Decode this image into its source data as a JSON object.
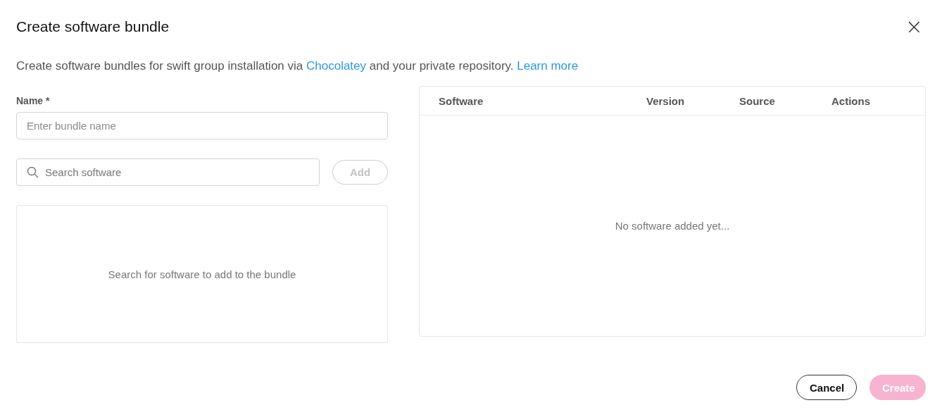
{
  "dialog": {
    "title": "Create software bundle",
    "close": "×"
  },
  "intro": [
    {
      "kind": "text",
      "text": "Create software bundles for swift group installation via "
    },
    {
      "kind": "link",
      "text": "Chocolatey"
    },
    {
      "kind": "text",
      "text": " and your private repository. "
    },
    {
      "kind": "link",
      "text": "Learn more"
    }
  ],
  "name_field": {
    "label": "Name *",
    "placeholder": "Enter bundle name"
  },
  "search": {
    "placeholder": "Search software",
    "add_button": {
      "label": "Add",
      "disabled": true
    }
  },
  "results": {
    "empty_text": "Search for software to add to the bundle"
  },
  "table": {
    "columns": [
      "Software",
      "Version",
      "Source",
      "Actions"
    ],
    "empty_text": "No software added yet..."
  },
  "buttons": [
    {
      "label": "Cancel",
      "kind": "secondary",
      "disabled": false
    },
    {
      "label": "Create",
      "kind": "primary",
      "disabled": true
    }
  ]
}
